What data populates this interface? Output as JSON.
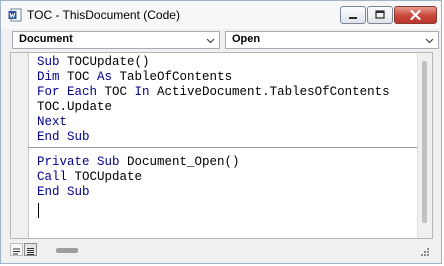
{
  "window": {
    "title": "TOC - ThisDocument (Code)"
  },
  "toolbar": {
    "object_combo": {
      "value": "Document"
    },
    "procedure_combo": {
      "value": "Open"
    }
  },
  "code": {
    "block1": [
      [
        {
          "t": "Sub ",
          "kw": true
        },
        {
          "t": "TOCUpdate()",
          "kw": false
        }
      ],
      [
        {
          "t": "Dim ",
          "kw": true
        },
        {
          "t": "TOC ",
          "kw": false
        },
        {
          "t": "As ",
          "kw": true
        },
        {
          "t": "TableOfContents",
          "kw": false
        }
      ],
      [
        {
          "t": "For Each ",
          "kw": true
        },
        {
          "t": "TOC ",
          "kw": false
        },
        {
          "t": "In ",
          "kw": true
        },
        {
          "t": "ActiveDocument.TablesOfContents",
          "kw": false
        }
      ],
      [
        {
          "t": "TOC.Update",
          "kw": false
        }
      ],
      [
        {
          "t": "Next",
          "kw": true
        }
      ],
      [
        {
          "t": "End Sub",
          "kw": true
        }
      ]
    ],
    "block2": [
      [
        {
          "t": "Private Sub ",
          "kw": true
        },
        {
          "t": "Document_Open()",
          "kw": false
        }
      ],
      [
        {
          "t": "Call ",
          "kw": true
        },
        {
          "t": "TOCUpdate",
          "kw": false
        }
      ],
      [
        {
          "t": "End Sub",
          "kw": true
        }
      ]
    ]
  },
  "colors": {
    "keyword": "#00008b",
    "text": "#000000"
  },
  "icons": {
    "app": "word-document-icon",
    "minimize": "minimize-icon",
    "maximize": "maximize-icon",
    "close": "close-icon",
    "dropdown": "chevron-down-icon",
    "procedure_view": "procedure-view-icon",
    "full_module_view": "full-module-view-icon"
  }
}
